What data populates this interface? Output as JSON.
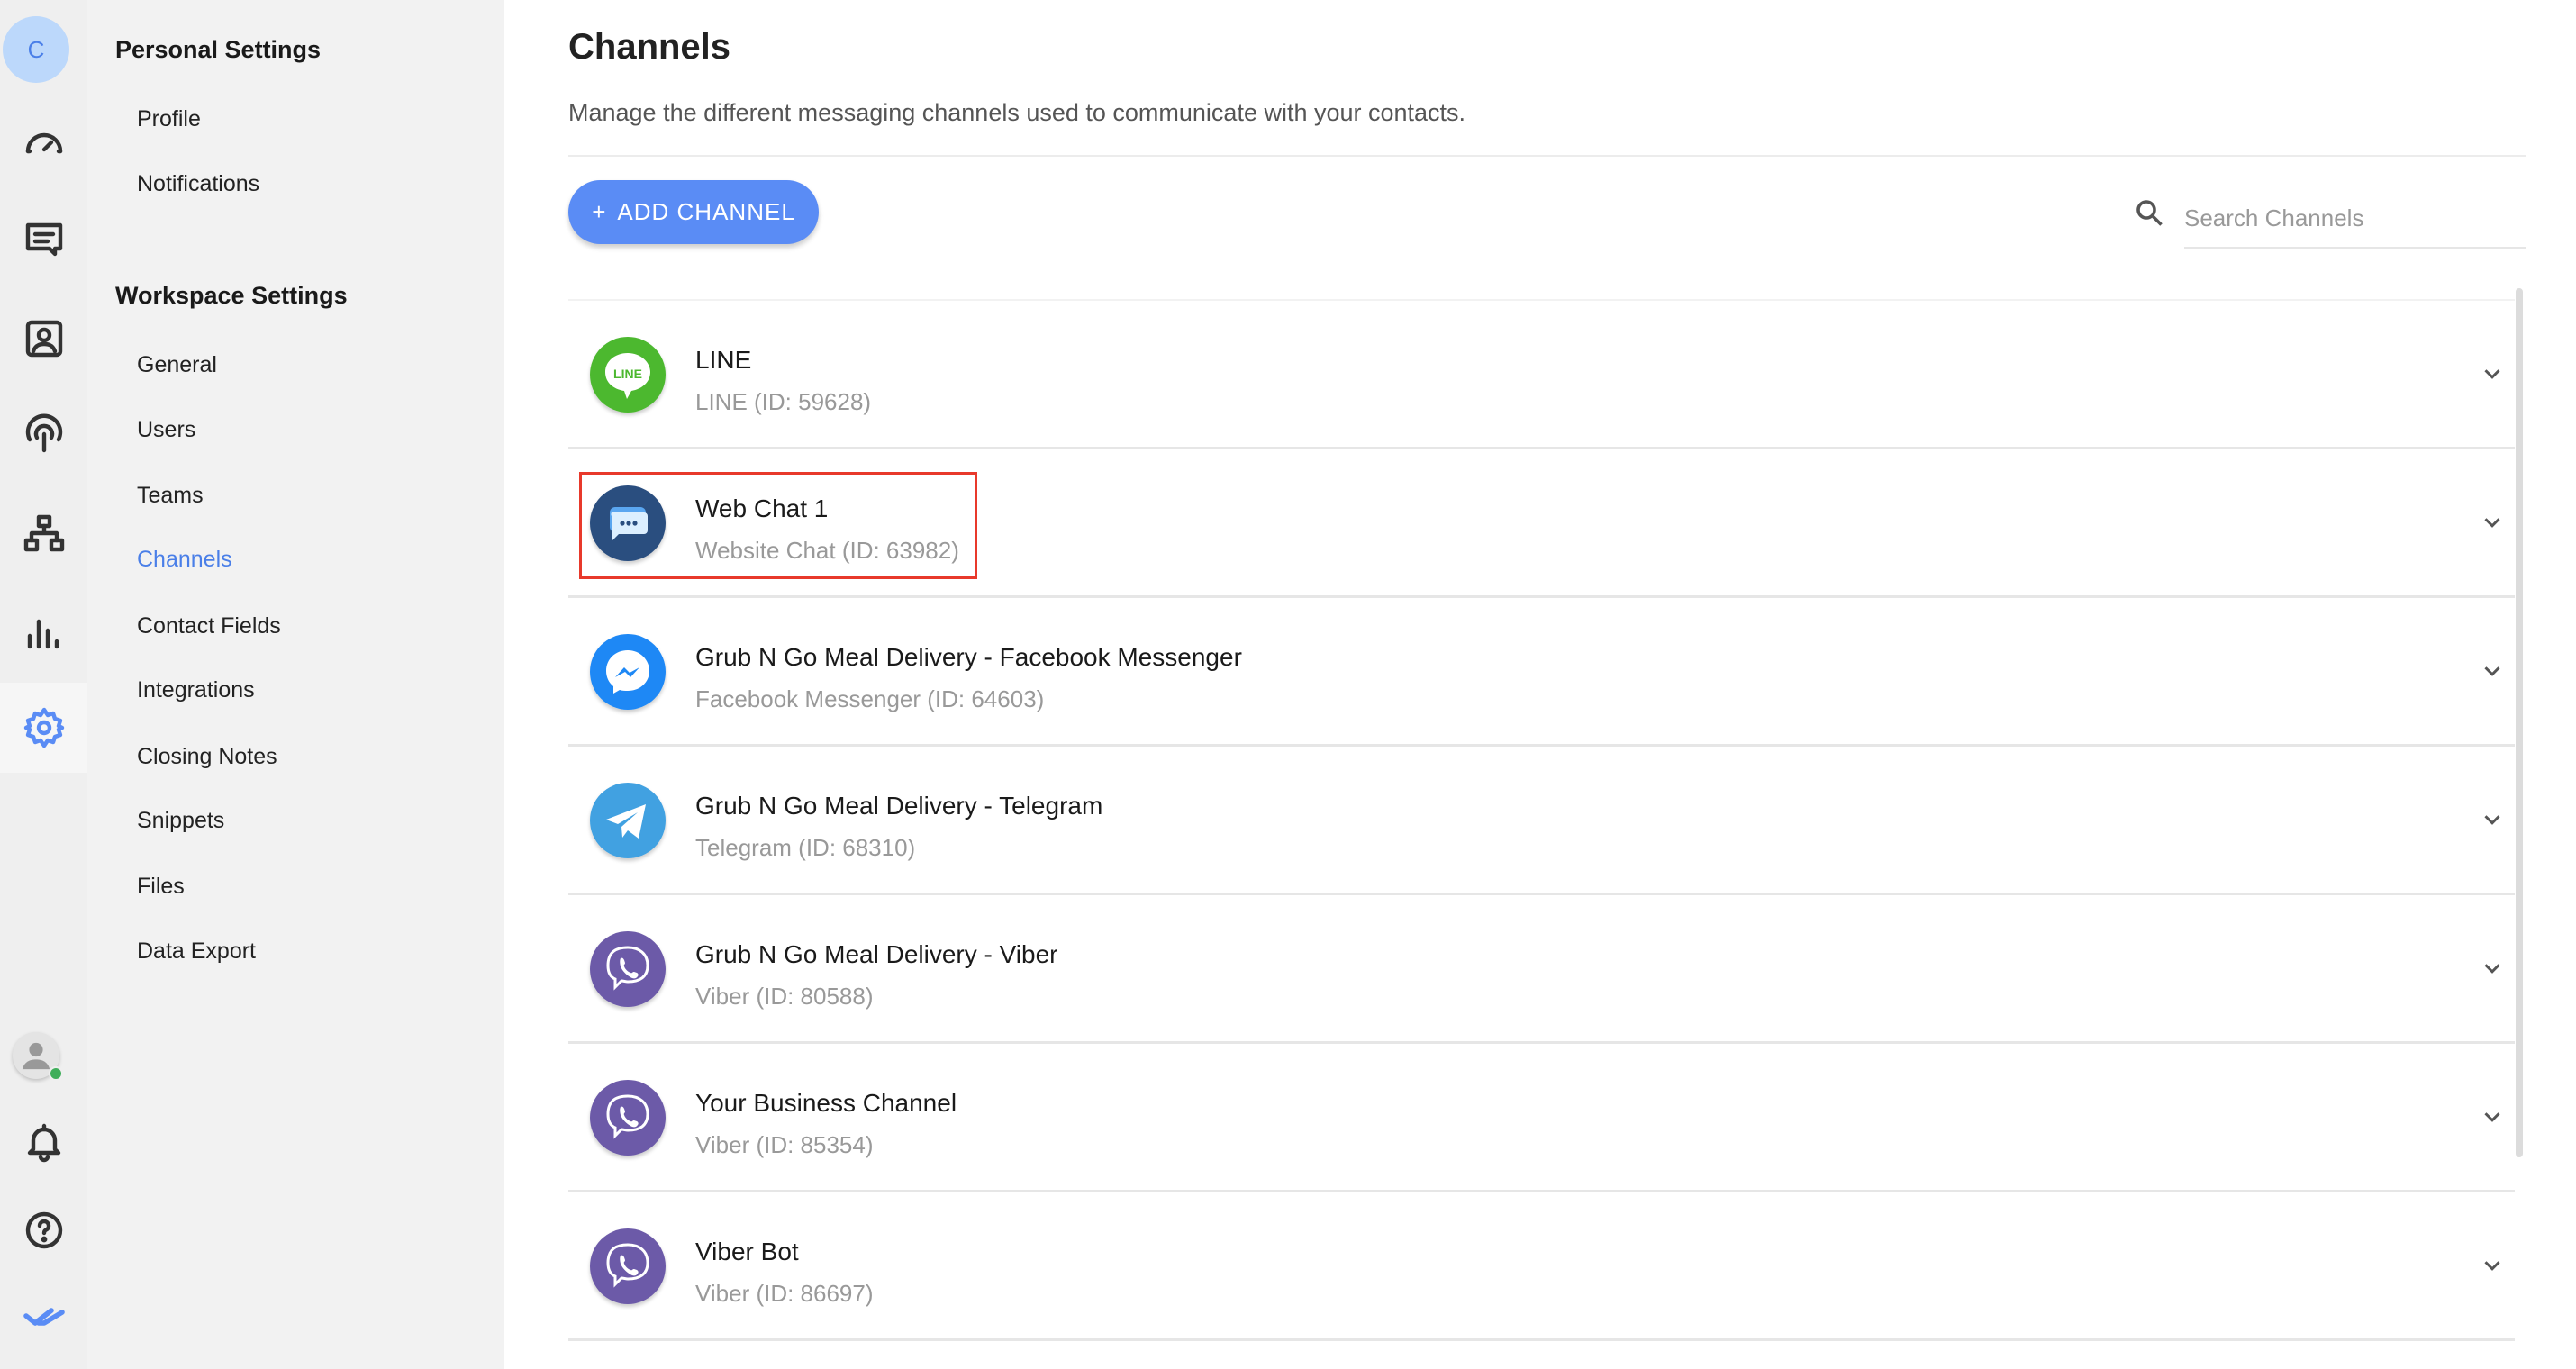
{
  "rail": {
    "workspace_initial": "C",
    "items": [
      "dashboard-icon",
      "messages-icon",
      "contacts-icon",
      "broadcast-icon",
      "workflows-icon",
      "reports-icon",
      "settings-icon"
    ],
    "bottom": [
      "user-avatar",
      "bell-icon",
      "help-icon",
      "logo-icon"
    ],
    "active": "settings-icon",
    "accent": "#5a8cf5"
  },
  "sidebar": {
    "personal_title": "Personal Settings",
    "personal_items": [
      {
        "label": "Profile"
      },
      {
        "label": "Notifications"
      }
    ],
    "workspace_title": "Workspace Settings",
    "workspace_items": [
      {
        "label": "General"
      },
      {
        "label": "Users"
      },
      {
        "label": "Teams"
      },
      {
        "label": "Channels",
        "active": true
      },
      {
        "label": "Contact Fields"
      },
      {
        "label": "Integrations"
      },
      {
        "label": "Closing Notes"
      },
      {
        "label": "Snippets"
      },
      {
        "label": "Files"
      },
      {
        "label": "Data Export"
      }
    ]
  },
  "main": {
    "title": "Channels",
    "subtitle": "Manage the different messaging channels used to communicate with your contacts.",
    "add_button": {
      "icon": "+",
      "label": "ADD CHANNEL"
    },
    "search": {
      "placeholder": "Search Channels",
      "value": ""
    },
    "channels": [
      {
        "name": "LINE",
        "sub": "LINE (ID: 59628)",
        "type": "line",
        "color": "#4cb82f"
      },
      {
        "name": "Web Chat 1",
        "sub": "Website Chat (ID: 63982)",
        "type": "webchat",
        "color": "#2a4e7f",
        "highlighted": true
      },
      {
        "name": "Grub N Go Meal Delivery - Facebook Messenger",
        "sub": "Facebook Messenger (ID: 64603)",
        "type": "messenger",
        "color": "#1e88f5"
      },
      {
        "name": "Grub N Go Meal Delivery - Telegram",
        "sub": "Telegram (ID: 68310)",
        "type": "telegram",
        "color": "#41a1e1"
      },
      {
        "name": "Grub N Go Meal Delivery - Viber",
        "sub": "Viber (ID: 80588)",
        "type": "viber",
        "color": "#6c5aa8"
      },
      {
        "name": "Your Business Channel",
        "sub": "Viber (ID: 85354)",
        "type": "viber",
        "color": "#6c5aa8"
      },
      {
        "name": "Viber Bot",
        "sub": "Viber (ID: 86697)",
        "type": "viber",
        "color": "#6c5aa8"
      }
    ],
    "line_logo_text": "LINE"
  }
}
